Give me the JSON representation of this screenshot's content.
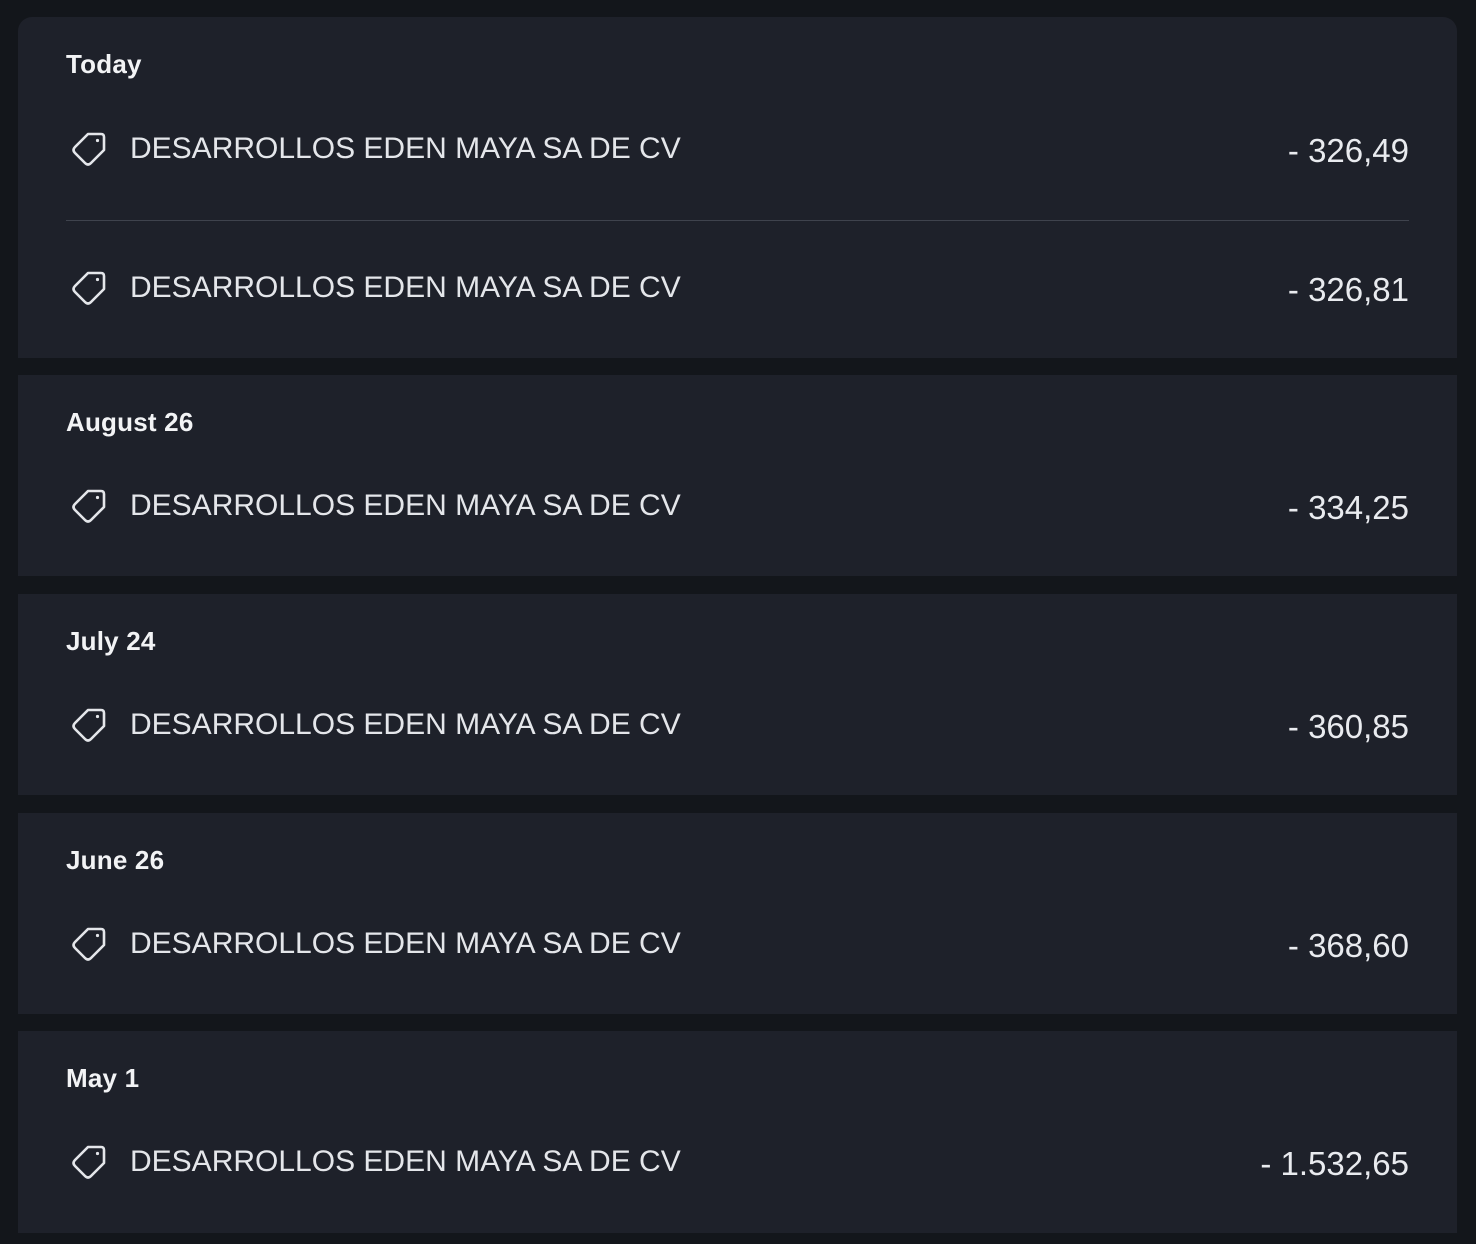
{
  "groups": [
    {
      "date": "Today",
      "transactions": [
        {
          "icon": "tag-icon",
          "merchant": "DESARROLLOS EDEN MAYA SA DE CV",
          "amount": "- 326,49"
        },
        {
          "icon": "tag-icon",
          "merchant": "DESARROLLOS EDEN MAYA SA DE CV",
          "amount": "- 326,81"
        }
      ]
    },
    {
      "date": "August 26",
      "transactions": [
        {
          "icon": "tag-icon",
          "merchant": "DESARROLLOS EDEN MAYA SA DE CV",
          "amount": "- 334,25"
        }
      ]
    },
    {
      "date": "July 24",
      "transactions": [
        {
          "icon": "tag-icon",
          "merchant": "DESARROLLOS EDEN MAYA SA DE CV",
          "amount": "- 360,85"
        }
      ]
    },
    {
      "date": "June 26",
      "transactions": [
        {
          "icon": "tag-icon",
          "merchant": "DESARROLLOS EDEN MAYA SA DE CV",
          "amount": "- 368,60"
        }
      ]
    },
    {
      "date": "May 1",
      "transactions": [
        {
          "icon": "tag-icon",
          "merchant": "DESARROLLOS EDEN MAYA SA DE CV",
          "amount": "- 1.532,65"
        }
      ]
    }
  ],
  "colors": {
    "page_background": "#13161b",
    "card_background": "#1e212a",
    "divider": "#3f434d",
    "text": "#e9ebef"
  }
}
